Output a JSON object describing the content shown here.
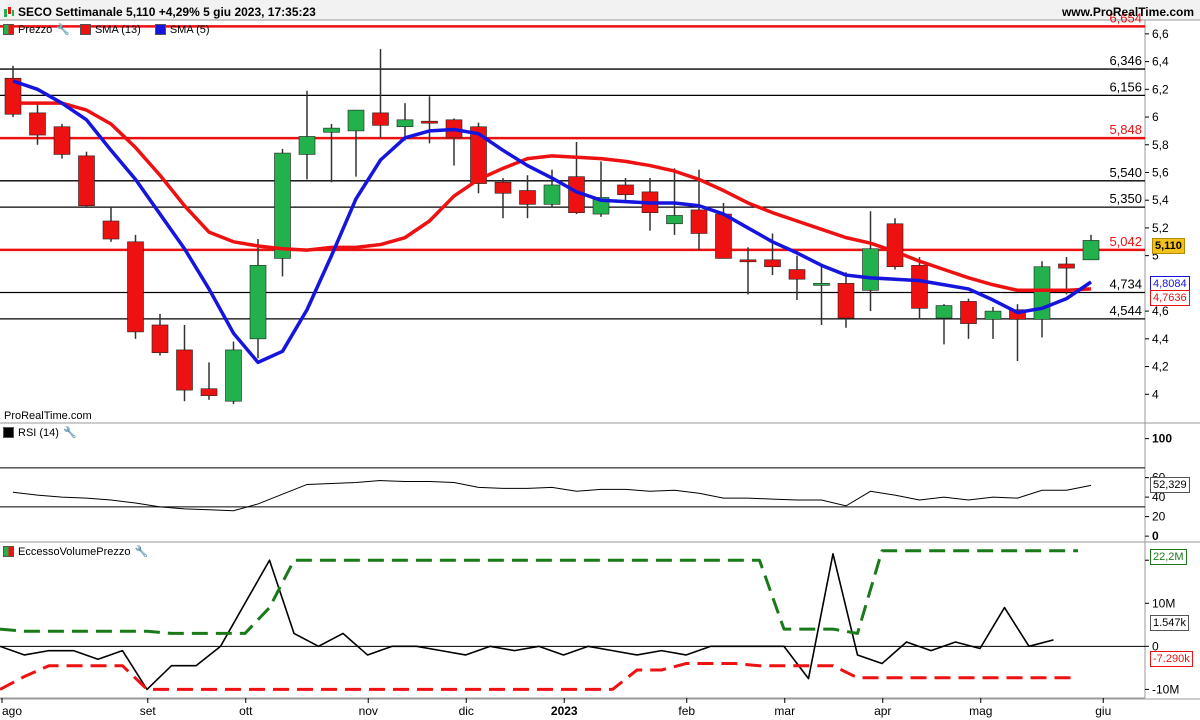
{
  "header": {
    "title": "SECO Settimanale 5,110 +4,29% 5 giu 2023, 17:35:23",
    "site": "www.ProRealTime.com"
  },
  "watermark": "ProRealTime.com",
  "legend": {
    "price_label": "Prezzo",
    "sma13_label": "SMA (13)",
    "sma5_label": "SMA (5)",
    "rsi_label": "RSI (14)",
    "evp_label": "EccessoVolumePrezzo"
  },
  "colors": {
    "up": "#22b14c",
    "down": "#ee1111",
    "sma13": "#ee1111",
    "sma5": "#1515dd",
    "hline_red": "#ee1111",
    "hline_black": "#000000",
    "evp_upper": "#1a7a1a",
    "evp_lower": "#ee1111",
    "current_price_bg": "#f3c11a"
  },
  "price_badges": {
    "current": "5,110",
    "sma5": "4,8084",
    "sma13": "4,7636"
  },
  "rsi_badge": "52,329",
  "evp_badges": {
    "upper": "22,2M",
    "line": "1.547k",
    "lower": "-7.290k"
  },
  "x_axis": {
    "labels": [
      "ago",
      "set",
      "ott",
      "nov",
      "dic",
      "2023",
      "feb",
      "mar",
      "apr",
      "mag",
      "giu"
    ],
    "label_weeks": [
      0,
      5.5,
      9.5,
      14.5,
      18.5,
      22.5,
      27.5,
      31.5,
      35.5,
      39.5,
      44.5
    ]
  },
  "chart_data": [
    {
      "type": "candlestick",
      "title": "SECO Settimanale",
      "ylim": [
        3.8,
        6.7
      ],
      "y_ticks": [
        4,
        4.2,
        4.4,
        4.6,
        5,
        5.2,
        5.4,
        5.6,
        5.8,
        6,
        6.2,
        6.4,
        6.6
      ],
      "y_tick_labels": [
        "4",
        "4,2",
        "4,4",
        "4,6",
        "5",
        "5,2",
        "5,4",
        "5,6",
        "5,8",
        "6",
        "6,2",
        "6,4",
        "6,6"
      ],
      "horizontal_levels": [
        {
          "value": 6.654,
          "label": "6,654",
          "color": "red"
        },
        {
          "value": 6.346,
          "label": "6,346",
          "color": "black"
        },
        {
          "value": 6.156,
          "label": "6,156",
          "color": "black"
        },
        {
          "value": 5.848,
          "label": "5,848",
          "color": "red"
        },
        {
          "value": 5.54,
          "label": "5,540",
          "color": "black"
        },
        {
          "value": 5.35,
          "label": "5,350",
          "color": "black"
        },
        {
          "value": 5.042,
          "label": "5,042",
          "color": "red"
        },
        {
          "value": 4.734,
          "label": "4,734",
          "color": "black"
        },
        {
          "value": 4.544,
          "label": "4,544",
          "color": "black"
        }
      ],
      "candles": [
        {
          "o": 6.28,
          "h": 6.37,
          "l": 6.0,
          "c": 6.02
        },
        {
          "o": 6.03,
          "h": 6.1,
          "l": 5.8,
          "c": 5.87
        },
        {
          "o": 5.93,
          "h": 5.95,
          "l": 5.7,
          "c": 5.73
        },
        {
          "o": 5.72,
          "h": 5.75,
          "l": 5.35,
          "c": 5.36
        },
        {
          "o": 5.25,
          "h": 5.35,
          "l": 5.1,
          "c": 5.12
        },
        {
          "o": 5.1,
          "h": 5.15,
          "l": 4.4,
          "c": 4.45
        },
        {
          "o": 4.5,
          "h": 4.58,
          "l": 4.28,
          "c": 4.3
        },
        {
          "o": 4.32,
          "h": 4.5,
          "l": 3.95,
          "c": 4.03
        },
        {
          "o": 4.04,
          "h": 4.23,
          "l": 3.96,
          "c": 3.99
        },
        {
          "o": 3.95,
          "h": 4.38,
          "l": 3.93,
          "c": 4.32
        },
        {
          "o": 4.4,
          "h": 5.12,
          "l": 4.26,
          "c": 4.93
        },
        {
          "o": 4.98,
          "h": 5.77,
          "l": 4.85,
          "c": 5.74
        },
        {
          "o": 5.73,
          "h": 6.19,
          "l": 5.55,
          "c": 5.86
        },
        {
          "o": 5.89,
          "h": 5.95,
          "l": 5.53,
          "c": 5.92
        },
        {
          "o": 5.9,
          "h": 6.05,
          "l": 5.57,
          "c": 6.05
        },
        {
          "o": 6.03,
          "h": 6.49,
          "l": 5.85,
          "c": 5.94
        },
        {
          "o": 5.93,
          "h": 6.1,
          "l": 5.83,
          "c": 5.98
        },
        {
          "o": 5.97,
          "h": 6.15,
          "l": 5.81,
          "c": 5.96
        },
        {
          "o": 5.98,
          "h": 5.99,
          "l": 5.65,
          "c": 5.85
        },
        {
          "o": 5.93,
          "h": 5.96,
          "l": 5.45,
          "c": 5.52
        },
        {
          "o": 5.53,
          "h": 5.56,
          "l": 5.27,
          "c": 5.45
        },
        {
          "o": 5.47,
          "h": 5.58,
          "l": 5.27,
          "c": 5.37
        },
        {
          "o": 5.37,
          "h": 5.62,
          "l": 5.35,
          "c": 5.51
        },
        {
          "o": 5.57,
          "h": 5.82,
          "l": 5.3,
          "c": 5.31
        },
        {
          "o": 5.3,
          "h": 5.68,
          "l": 5.28,
          "c": 5.42
        },
        {
          "o": 5.51,
          "h": 5.56,
          "l": 5.38,
          "c": 5.44
        },
        {
          "o": 5.46,
          "h": 5.56,
          "l": 5.18,
          "c": 5.31
        },
        {
          "o": 5.23,
          "h": 5.63,
          "l": 5.15,
          "c": 5.29
        },
        {
          "o": 5.33,
          "h": 5.62,
          "l": 5.04,
          "c": 5.16
        },
        {
          "o": 5.3,
          "h": 5.38,
          "l": 4.98,
          "c": 4.98
        },
        {
          "o": 4.97,
          "h": 5.06,
          "l": 4.72,
          "c": 4.96
        },
        {
          "o": 4.97,
          "h": 5.16,
          "l": 4.86,
          "c": 4.92
        },
        {
          "o": 4.9,
          "h": 5.0,
          "l": 4.68,
          "c": 4.83
        },
        {
          "o": 4.8,
          "h": 4.93,
          "l": 4.5,
          "c": 4.8
        },
        {
          "o": 4.8,
          "h": 4.88,
          "l": 4.48,
          "c": 4.55
        },
        {
          "o": 4.75,
          "h": 5.32,
          "l": 4.6,
          "c": 5.05
        },
        {
          "o": 5.23,
          "h": 5.27,
          "l": 4.9,
          "c": 4.92
        },
        {
          "o": 4.93,
          "h": 4.99,
          "l": 4.54,
          "c": 4.62
        },
        {
          "o": 4.55,
          "h": 4.65,
          "l": 4.36,
          "c": 4.64
        },
        {
          "o": 4.67,
          "h": 4.69,
          "l": 4.4,
          "c": 4.51
        },
        {
          "o": 4.54,
          "h": 4.63,
          "l": 4.4,
          "c": 4.6
        },
        {
          "o": 4.61,
          "h": 4.65,
          "l": 4.24,
          "c": 4.54
        },
        {
          "o": 4.54,
          "h": 4.96,
          "l": 4.41,
          "c": 4.92
        },
        {
          "o": 4.94,
          "h": 4.99,
          "l": 4.72,
          "c": 4.91
        },
        {
          "o": 4.97,
          "h": 5.15,
          "l": 4.97,
          "c": 5.11
        }
      ],
      "series": [
        {
          "name": "SMA (13)",
          "values": [
            6.1,
            6.1,
            6.1,
            6.05,
            5.95,
            5.78,
            5.58,
            5.36,
            5.17,
            5.1,
            5.07,
            5.05,
            5.04,
            5.06,
            5.06,
            5.08,
            5.13,
            5.25,
            5.43,
            5.55,
            5.63,
            5.7,
            5.72,
            5.71,
            5.7,
            5.68,
            5.65,
            5.61,
            5.55,
            5.47,
            5.38,
            5.31,
            5.25,
            5.19,
            5.13,
            5.09,
            5.03,
            4.96,
            4.9,
            4.84,
            4.79,
            4.75,
            4.75,
            4.75,
            4.76
          ]
        },
        {
          "name": "SMA (5)",
          "values": [
            6.26,
            6.2,
            6.1,
            5.98,
            5.76,
            5.55,
            5.3,
            5.05,
            4.76,
            4.44,
            4.23,
            4.31,
            4.61,
            5.0,
            5.41,
            5.69,
            5.85,
            5.9,
            5.91,
            5.88,
            5.76,
            5.65,
            5.56,
            5.46,
            5.4,
            5.39,
            5.38,
            5.38,
            5.36,
            5.3,
            5.2,
            5.1,
            5.02,
            4.93,
            4.86,
            4.84,
            4.83,
            4.82,
            4.79,
            4.76,
            4.68,
            4.59,
            4.62,
            4.69,
            4.81
          ]
        }
      ]
    },
    {
      "type": "line",
      "title": "RSI (14)",
      "ylim": [
        -5,
        115
      ],
      "y_ticks": [
        0,
        20,
        40,
        60,
        100
      ],
      "y_tick_labels": [
        "0",
        "20",
        "40",
        "60",
        "100"
      ],
      "levels": [
        70,
        30
      ],
      "series": [
        {
          "name": "RSI (14)",
          "values": [
            45,
            42,
            40,
            39,
            37,
            34,
            30,
            28,
            27,
            26,
            33,
            43,
            53,
            54,
            55,
            57,
            56,
            56,
            55,
            50,
            49,
            49,
            50,
            46,
            48,
            48,
            46,
            47,
            44,
            39,
            39,
            38,
            37,
            37,
            31,
            46,
            42,
            37,
            40,
            37,
            40,
            39,
            47,
            47,
            52
          ]
        }
      ]
    },
    {
      "type": "line",
      "title": "EccessoVolumePrezzo",
      "ylim": [
        -12,
        24
      ],
      "y_ticks": [
        20,
        10,
        0,
        -10
      ],
      "y_tick_labels": [
        "20M",
        "10M",
        "0",
        "-10M"
      ],
      "series": [
        {
          "name": "line",
          "values": [
            0,
            -2,
            -1,
            -1,
            -3,
            -1,
            -10,
            -4.5,
            -4.5,
            0,
            10,
            20,
            3,
            0,
            3,
            -2,
            0,
            0,
            -1,
            -2,
            0,
            -1,
            0,
            -2,
            0,
            -1,
            -2,
            -1,
            -2,
            0,
            0,
            0,
            0,
            -7.5,
            21.5,
            -2,
            -4,
            1,
            -1,
            1,
            -0.5,
            9,
            0,
            1.5
          ]
        },
        {
          "name": "upper",
          "values": [
            4,
            3.5,
            3.5,
            3.5,
            3.5,
            3.5,
            3.5,
            3,
            3,
            3,
            3,
            9,
            20,
            20,
            20,
            20,
            20,
            20,
            20,
            20,
            20,
            20,
            20,
            20,
            20,
            20,
            20,
            20,
            20,
            20,
            20,
            20,
            4,
            4,
            4,
            3,
            22.2,
            22.2,
            22.2,
            22.2,
            22.2,
            22.2,
            22.2,
            22.2,
            22.2
          ]
        },
        {
          "name": "lower",
          "values": [
            -10,
            -7,
            -4.5,
            -4.5,
            -4.5,
            -4.5,
            -10,
            -10,
            -10,
            -10,
            -10,
            -10,
            -10,
            -10,
            -10,
            -10,
            -10,
            -10,
            -10,
            -10,
            -10,
            -10,
            -10,
            -10,
            -10,
            -10,
            -5.5,
            -5.5,
            -4,
            -4,
            -4,
            -4.5,
            -4.5,
            -4.5,
            -4.5,
            -7.3,
            -7.3,
            -7.3,
            -7.3,
            -7.3,
            -7.3,
            -7.3,
            -7.3,
            -7.3,
            -7.3
          ]
        }
      ]
    }
  ]
}
